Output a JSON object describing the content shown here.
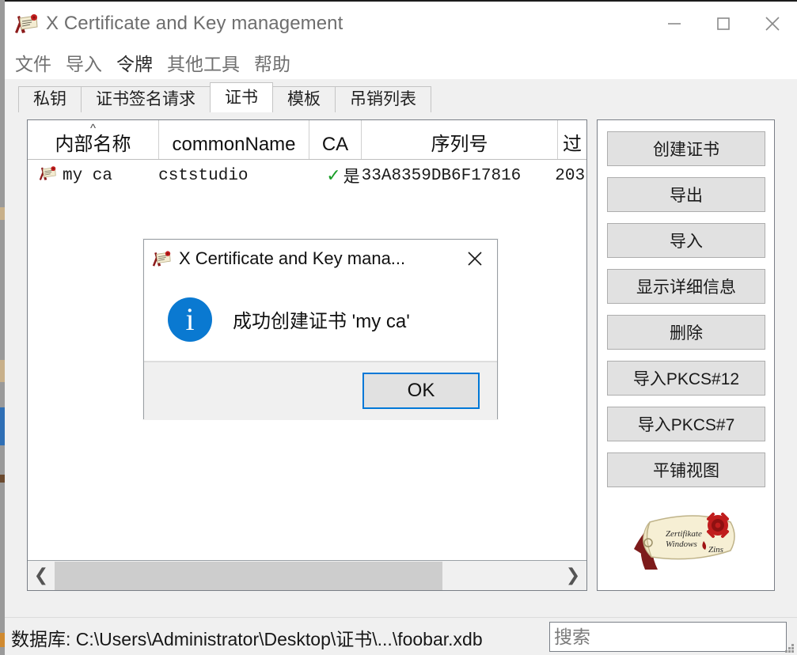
{
  "window": {
    "title": "X Certificate and Key management",
    "icon": "certificate-icon",
    "controls": {
      "minimize": "minimize-icon",
      "maximize": "maximize-icon",
      "close": "close-icon"
    }
  },
  "menubar": {
    "items": [
      {
        "label": "文件"
      },
      {
        "label": "导入"
      },
      {
        "label": "令牌"
      },
      {
        "label": "其他工具"
      },
      {
        "label": "帮助"
      }
    ]
  },
  "tabs": [
    {
      "label": "私钥",
      "active": false
    },
    {
      "label": "证书签名请求",
      "active": false
    },
    {
      "label": "证书",
      "active": true
    },
    {
      "label": "模板",
      "active": false
    },
    {
      "label": "吊销列表",
      "active": false
    }
  ],
  "table": {
    "sort_column": "内部名称",
    "sort_caret": "^",
    "columns": [
      {
        "label": "内部名称"
      },
      {
        "label": "commonName"
      },
      {
        "label": "CA"
      },
      {
        "label": "序列号"
      },
      {
        "label": "过"
      }
    ],
    "rows": [
      {
        "icon": "certificate-icon",
        "internal_name": "my ca",
        "common_name": "cststudio",
        "ca_check": "✓",
        "ca_value": "是",
        "serial": "33A8359DB6F17816",
        "expiry": "203"
      }
    ]
  },
  "scrollbar": {
    "left_arrow": "chevron-left-icon",
    "right_arrow": "chevron-right-icon"
  },
  "side_buttons": [
    {
      "label": "创建证书"
    },
    {
      "label": "导出"
    },
    {
      "label": "导入"
    },
    {
      "label": "显示详细信息"
    },
    {
      "label": "删除"
    },
    {
      "label": "导入PKCS#12"
    },
    {
      "label": "导入PKCS#7"
    },
    {
      "label": "平铺视图"
    }
  ],
  "side_logo": {
    "name": "certificate-scroll-logo",
    "line1": "Zertifikate",
    "line2": "Windows",
    "line3": "Zins"
  },
  "statusbar": {
    "database_label": "数据库: C:\\Users\\Administrator\\Desktop\\证书\\...\\foobar.xdb",
    "search_placeholder": "搜索",
    "search_value": ""
  },
  "dialog": {
    "icon": "certificate-icon",
    "title": "X Certificate and Key mana...",
    "close": "close-icon",
    "message_icon": "info-icon",
    "message_icon_glyph": "i",
    "message": "成功创建证书 'my ca'",
    "ok_label": "OK"
  },
  "colors": {
    "accent": "#0078d7",
    "info": "#0a79d1",
    "check": "#1a9e28",
    "panel": "#f0f0f0",
    "button": "#e1e1e1"
  }
}
